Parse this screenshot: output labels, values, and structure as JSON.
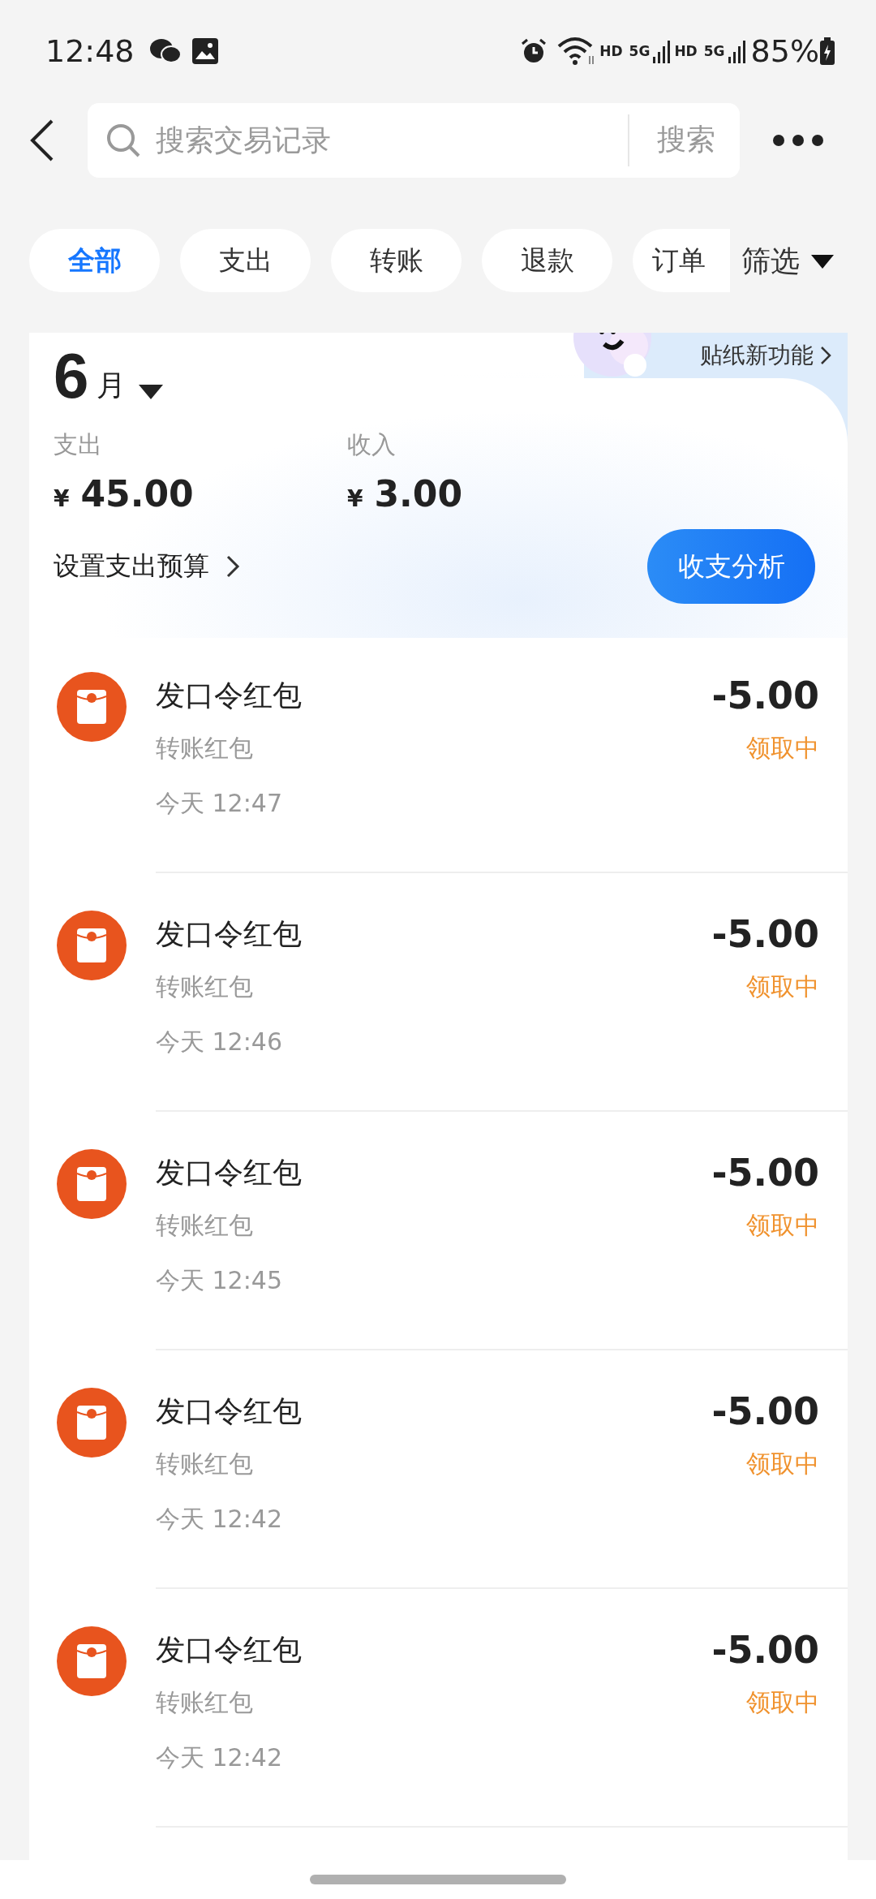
{
  "status_bar": {
    "time": "12:48",
    "network_labels": [
      "HD",
      "5G",
      "HD",
      "5G"
    ],
    "battery": "85%"
  },
  "search": {
    "placeholder": "搜索交易记录",
    "button": "搜索"
  },
  "filter_chips": [
    {
      "label": "全部",
      "selected": true
    },
    {
      "label": "支出",
      "selected": false
    },
    {
      "label": "转账",
      "selected": false
    },
    {
      "label": "退款",
      "selected": false
    },
    {
      "label": "订单",
      "selected": false
    }
  ],
  "filter_button": "筛选",
  "promo": "贴纸新功能",
  "summary": {
    "month": "6",
    "month_unit": "月",
    "expense_label": "支出",
    "expense_currency": "¥",
    "expense": "45.00",
    "income_label": "收入",
    "income_currency": "¥",
    "income": "3.00",
    "budget_link": "设置支出预算",
    "analysis_button": "收支分析"
  },
  "transactions": [
    {
      "title": "发口令红包",
      "category": "转账红包",
      "time": "今天 12:47",
      "amount": "-5.00",
      "status": "领取中"
    },
    {
      "title": "发口令红包",
      "category": "转账红包",
      "time": "今天 12:46",
      "amount": "-5.00",
      "status": "领取中"
    },
    {
      "title": "发口令红包",
      "category": "转账红包",
      "time": "今天 12:45",
      "amount": "-5.00",
      "status": "领取中"
    },
    {
      "title": "发口令红包",
      "category": "转账红包",
      "time": "今天 12:42",
      "amount": "-5.00",
      "status": "领取中"
    },
    {
      "title": "发口令红包",
      "category": "转账红包",
      "time": "今天 12:42",
      "amount": "-5.00",
      "status": "领取中"
    }
  ]
}
